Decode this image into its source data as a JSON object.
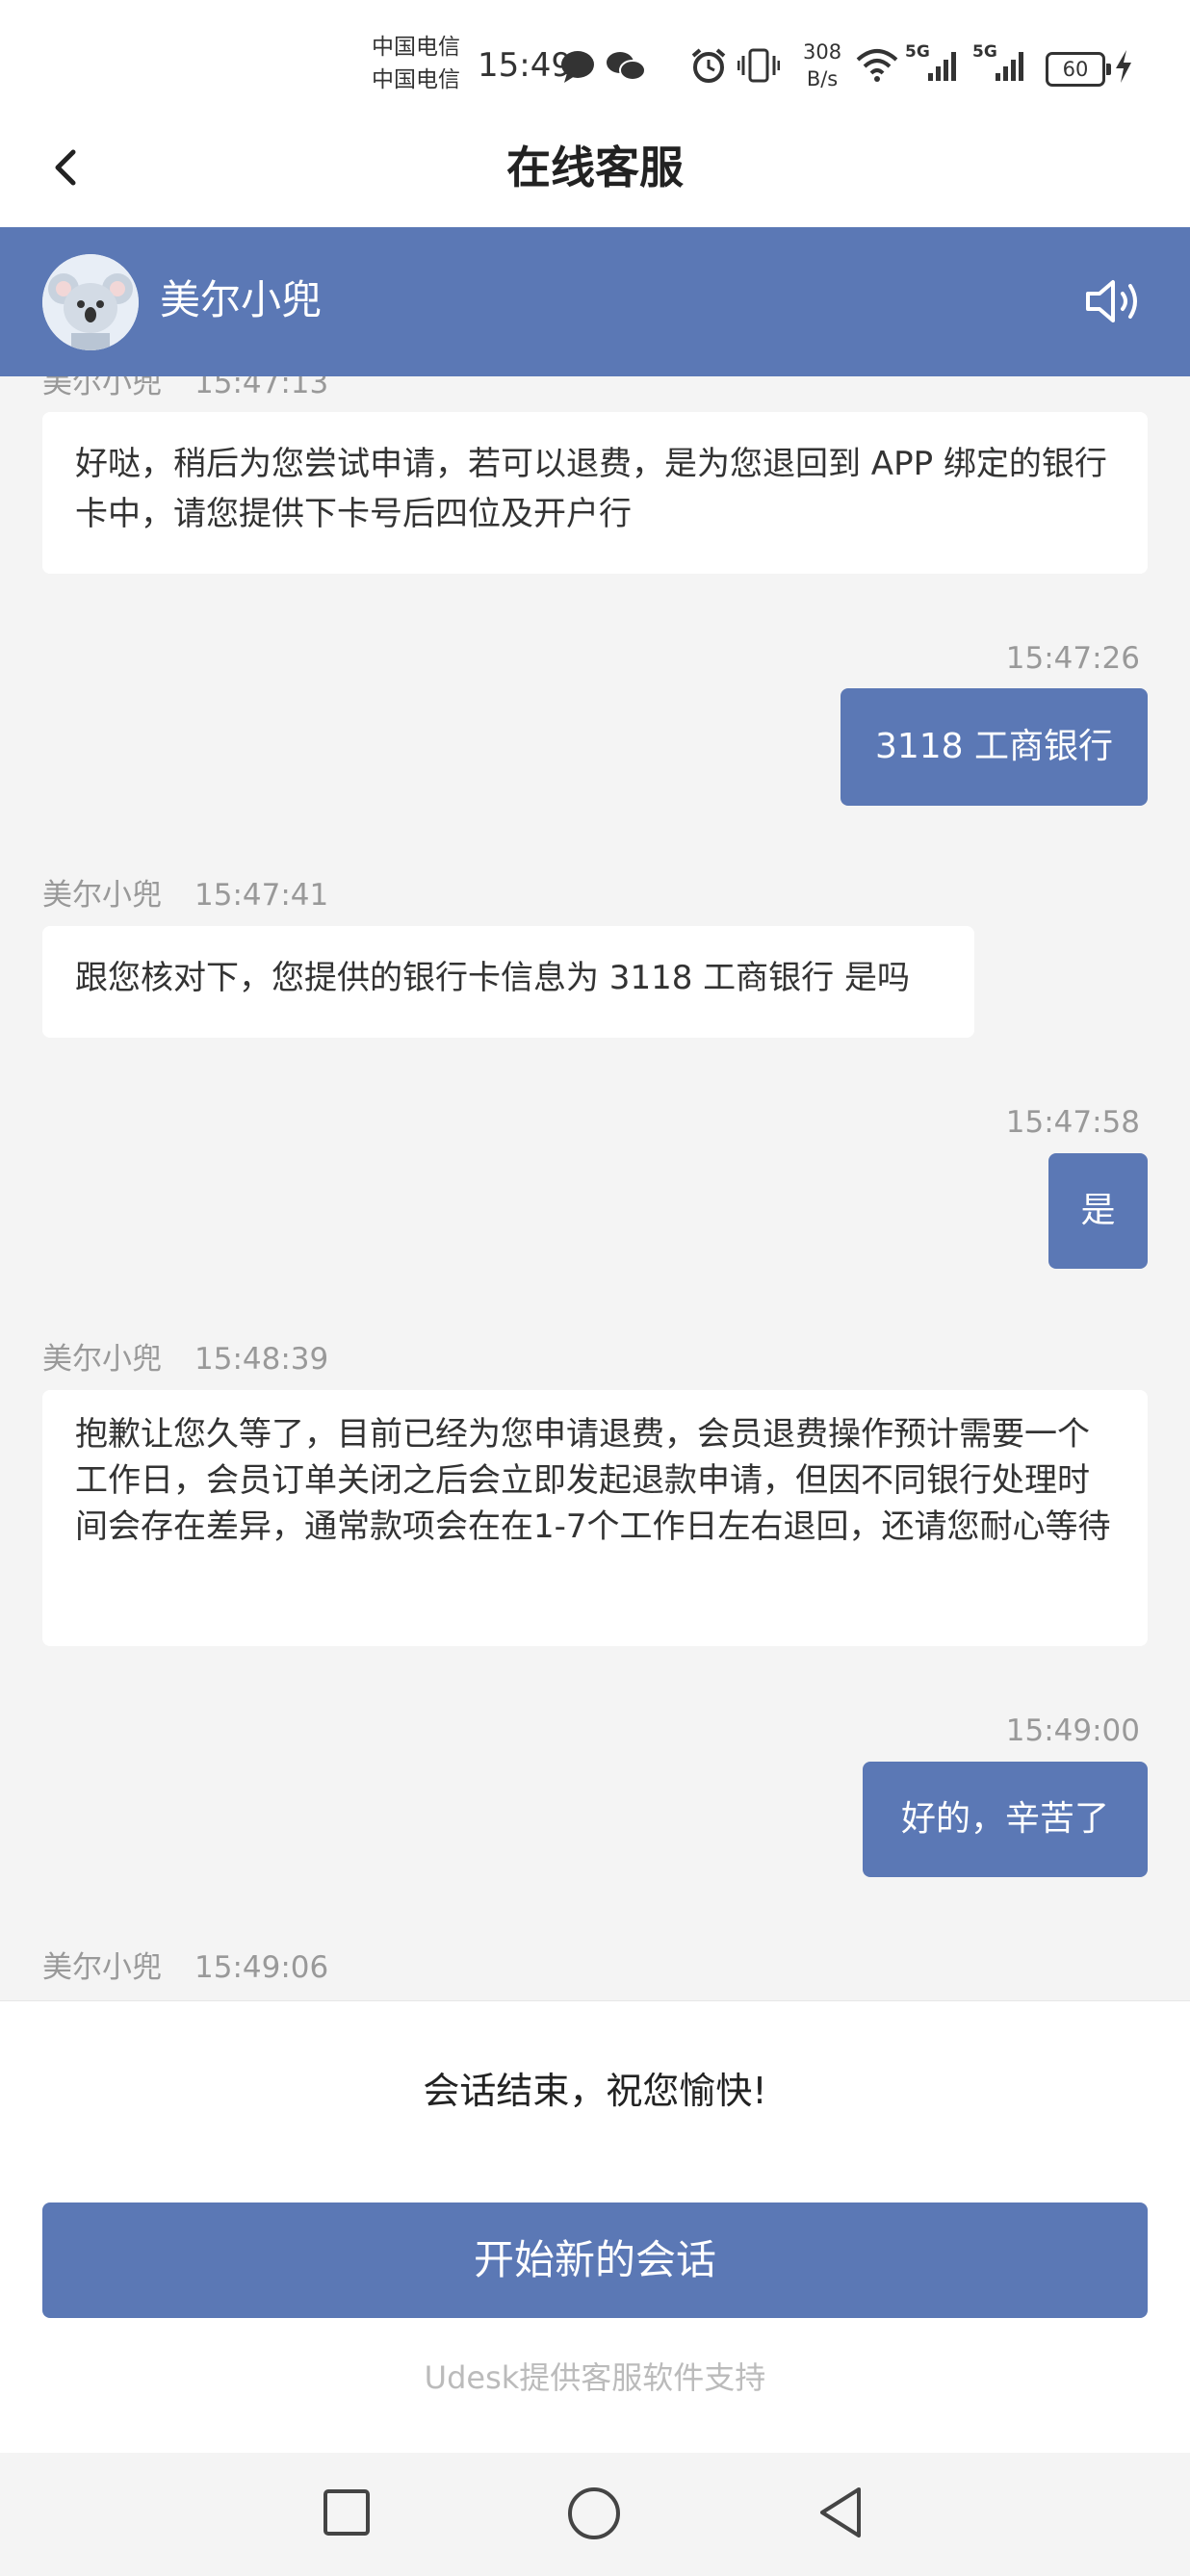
{
  "status_bar": {
    "carrier_1": "中国电信",
    "carrier_2": "中国电信",
    "time": "15:49",
    "speed_value": "308",
    "speed_unit": "B/s",
    "network_1": "5G",
    "network_2": "5G",
    "battery": "60"
  },
  "header": {
    "title": "在线客服"
  },
  "agent": {
    "name": "美尔小兜"
  },
  "messages": [
    {
      "meta_name": "美尔小兜",
      "meta_time": "15:47:13",
      "text": "好哒，稍后为您尝试申请，若可以退费，是为您退回到 APP 绑定的银行卡中，请您提供下卡号后四位及开户行"
    },
    {
      "time": "15:47:26",
      "text": "3118 工商银行"
    },
    {
      "meta_name": "美尔小兜",
      "meta_time": "15:47:41",
      "text": "跟您核对下，您提供的银行卡信息为 3118 工商银行 是吗"
    },
    {
      "time": "15:47:58",
      "text": "是"
    },
    {
      "meta_name": "美尔小兜",
      "meta_time": "15:48:39",
      "text": "抱歉让您久等了，目前已经为您申请退费，会员退费操作预计需要一个工作日，会员订单关闭之后会立即发起退款申请，但因不同银行处理时间会存在差异，通常款项会在在1-7个工作日左右退回，还请您耐心等待"
    },
    {
      "time": "15:49:00",
      "text": "好的，辛苦了"
    },
    {
      "meta_name": "美尔小兜",
      "meta_time": "15:49:06"
    }
  ],
  "footer": {
    "end_text": "会话结束，祝您愉快!",
    "new_session_label": "开始新的会话",
    "powered_by": "Udesk提供客服软件支持"
  },
  "colors": {
    "accent": "#5b78b5",
    "background": "#f4f4f4"
  }
}
